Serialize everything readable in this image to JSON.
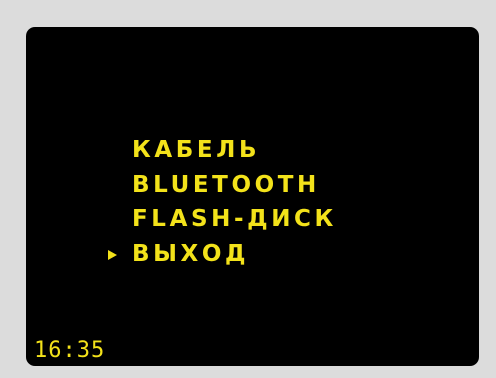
{
  "menu": {
    "items": [
      {
        "label": "КАБЕЛЬ",
        "selected": false
      },
      {
        "label": "BLUETOOTH",
        "selected": false
      },
      {
        "label": "FLASH-ДИСК",
        "selected": false
      },
      {
        "label": "ВЫХОД",
        "selected": true
      }
    ]
  },
  "status": {
    "time": "16:35"
  },
  "colors": {
    "text": "#f3e21a",
    "screen_bg": "#000000",
    "bezel": "#dcdcdc"
  },
  "icons": {
    "selection": "pointer-icon"
  }
}
